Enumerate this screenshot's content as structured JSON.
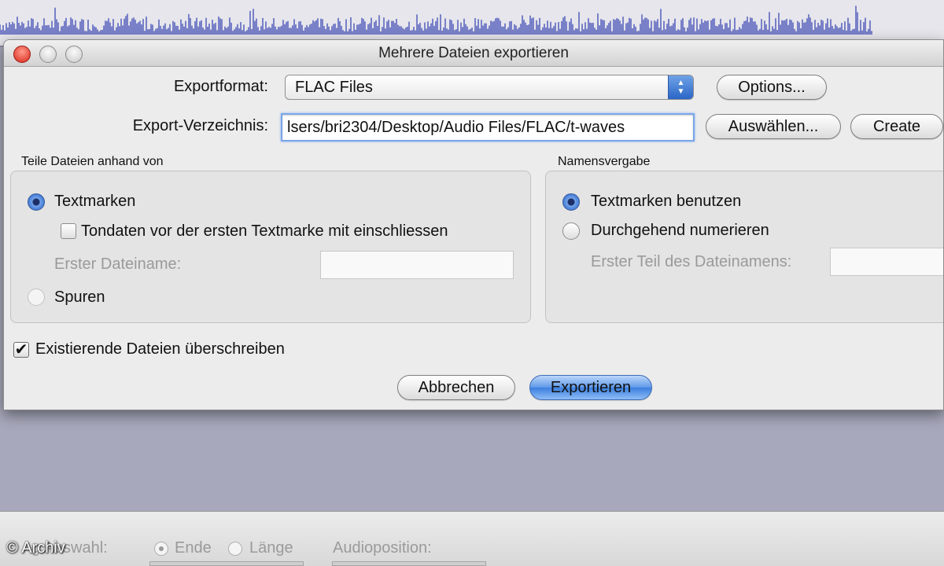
{
  "dialog": {
    "title": "Mehrere Dateien exportieren",
    "export_format": {
      "label": "Exportformat:",
      "value": "FLAC Files",
      "options_button": "Options..."
    },
    "export_dir": {
      "label": "Export-Verzeichnis:",
      "value": "lsers/bri2304/Desktop/Audio Files/FLAC/t-waves",
      "choose_button": "Auswählen...",
      "create_button": "Create"
    },
    "split_group": {
      "title": "Teile Dateien anhand von",
      "radio_markers": "Textmarken",
      "radio_markers_selected": true,
      "include_before_label": "Tondaten vor der ersten Textmarke mit einschliessen",
      "include_before_checked": false,
      "first_filename_label": "Erster Dateiname:",
      "first_filename_value": "",
      "radio_tracks": "Spuren",
      "radio_tracks_selected": false
    },
    "naming_group": {
      "title": "Namensvergabe",
      "radio_use_markers": "Textmarken benutzen",
      "radio_use_markers_selected": true,
      "radio_numbering": "Durchgehend numerieren",
      "radio_numbering_selected": false,
      "first_part_label": "Erster Teil des Dateinamens:",
      "first_part_value": ""
    },
    "overwrite": {
      "label": "Existierende Dateien überschreiben",
      "checked": true
    },
    "cancel_button": "Abbrechen",
    "export_button": "Exportieren"
  },
  "background": {
    "status_bar": {
      "selection_label_fragment": "g Auswahl:",
      "radio_end": "Ende",
      "radio_end_selected": true,
      "radio_length": "Länge",
      "radio_length_selected": false,
      "audio_position_label": "Audioposition:"
    },
    "watermark": "© Archiv"
  },
  "colors": {
    "waveform": "#4a55b8",
    "background": "#a8a9ba",
    "dialog": "#ececec",
    "accent": "#3b7fde"
  }
}
